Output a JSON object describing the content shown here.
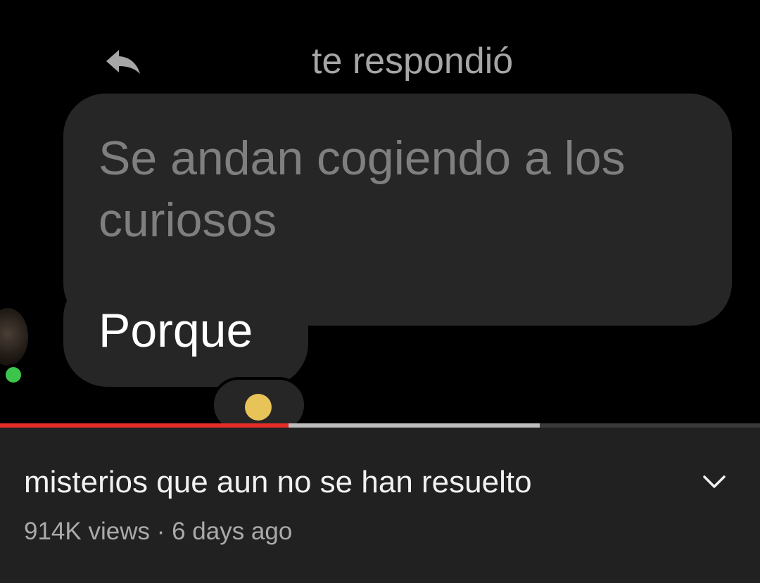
{
  "chat": {
    "reply_header": "te respondió",
    "quoted_message": "Se andan cogiendo a los curiosos",
    "reply_message": "Porque",
    "reply_icon": "reply-arrow-icon",
    "reaction_icon": "emoji-reaction-icon"
  },
  "player": {
    "played_fraction": 0.38,
    "buffered_fraction": 0.71,
    "played_color": "#e52d27",
    "buffer_color": "#bdbdbd"
  },
  "video": {
    "title": "misterios que aun no se han resuelto",
    "meta": "914K views · 6 days ago",
    "expand_icon": "chevron-down-icon"
  }
}
